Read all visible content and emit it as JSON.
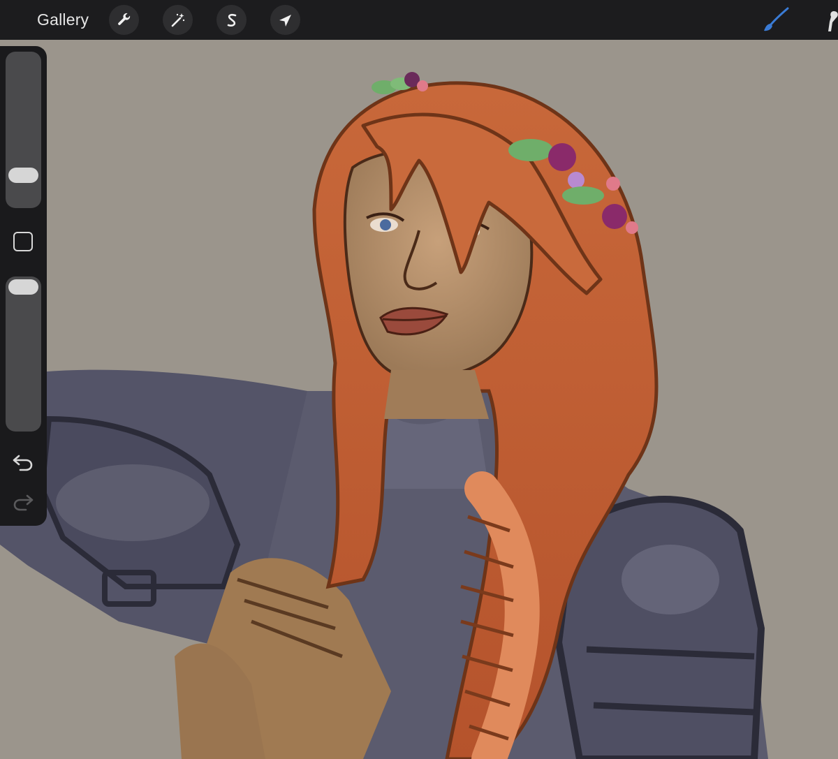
{
  "topbar": {
    "gallery_label": "Gallery",
    "tools": [
      {
        "name": "actions",
        "icon": "wrench-icon"
      },
      {
        "name": "adjustments",
        "icon": "magic-wand-icon"
      },
      {
        "name": "selection",
        "icon": "selection-s-icon"
      },
      {
        "name": "transform",
        "icon": "arrow-cursor-icon"
      }
    ],
    "active_tool": "brush",
    "active_color": "#3a7bd5"
  },
  "sidebar": {
    "brush_size_level": 0.22,
    "opacity_level": 1.0,
    "buttons": [
      "modify-button",
      "undo-button",
      "redo-button"
    ]
  },
  "canvas": {
    "background_color": "#9b958c",
    "artwork": "painting"
  }
}
